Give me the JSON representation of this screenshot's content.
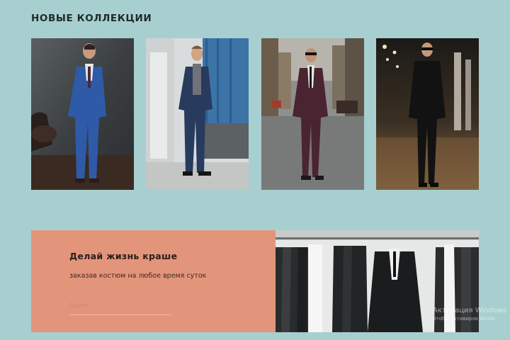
{
  "section": {
    "title": "НОВЫЕ КОЛЛЕКЦИИ"
  },
  "gallery": {
    "photos": [
      {
        "subject": "man in blue suit in studio"
      },
      {
        "subject": "man in navy suit and grey turtleneck by building"
      },
      {
        "subject": "man in burgundy suit walking in street"
      },
      {
        "subject": "man in black suit at night"
      }
    ]
  },
  "promo": {
    "heading": "Делай жизнь краше",
    "subtitle": "заказав костюм на любое время суток",
    "search_placeholder": "Поиск",
    "search_value": "",
    "photo": {
      "subject": "suits hanging on a rack"
    }
  },
  "watermark": {
    "title": "Активация Windows",
    "text": "Чтобы активиров Windo"
  },
  "colors": {
    "background": "#a8cfcf",
    "promo_panel": "#e3957b",
    "title_text": "#1f2a2a"
  }
}
